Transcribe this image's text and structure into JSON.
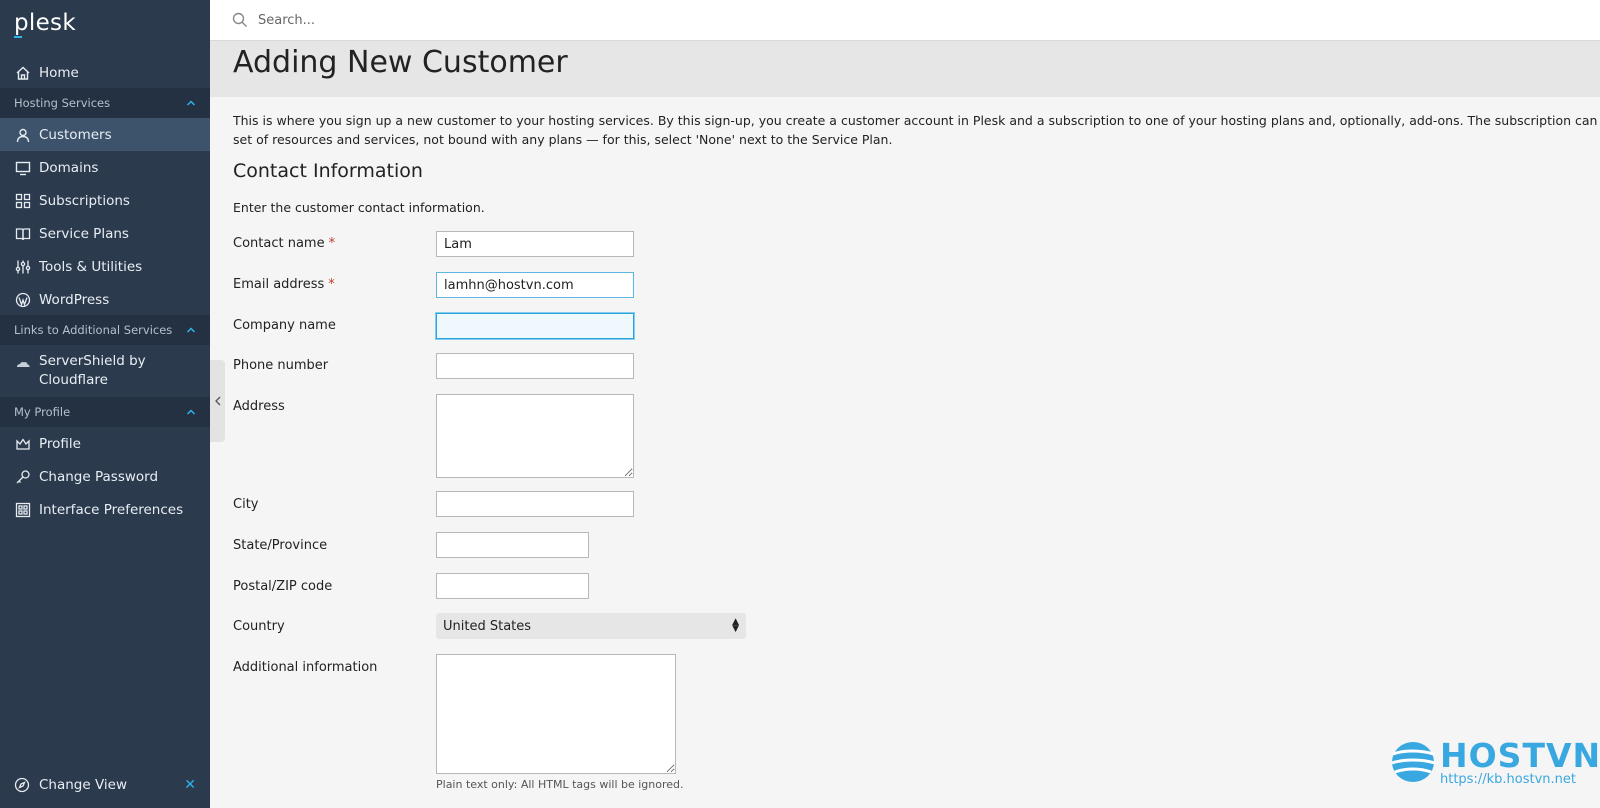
{
  "app": {
    "logo": "plesk"
  },
  "search": {
    "placeholder": "Search..."
  },
  "sidebar": {
    "home": "Home",
    "section_hosting": "Hosting Services",
    "customers": "Customers",
    "domains": "Domains",
    "subscriptions": "Subscriptions",
    "service_plans": "Service Plans",
    "tools": "Tools & Utilities",
    "wordpress": "WordPress",
    "section_links": "Links to Additional Services",
    "servershield_line1": "ServerShield by",
    "servershield_line2": "Cloudflare",
    "section_profile": "My Profile",
    "profile": "Profile",
    "change_password": "Change Password",
    "interface_prefs": "Interface Preferences",
    "change_view": "Change View"
  },
  "page": {
    "title": "Adding New Customer",
    "intro_line1": "This is where you sign up a new customer to your hosting services. By this sign-up, you create a customer account in Plesk and a subscription to one of your hosting plans and, optionally, add-ons. The subscription can also pro",
    "intro_line2": "set of resources and services, not bound with any plans — for this, select 'None' next to the Service Plan."
  },
  "contact": {
    "title": "Contact Information",
    "description": "Enter the customer contact information.",
    "contact_name_label": "Contact name",
    "contact_name_value": "Lam",
    "email_label": "Email address",
    "email_value": "lamhn@hostvn.com",
    "company_label": "Company name",
    "company_value": "",
    "phone_label": "Phone number",
    "address_label": "Address",
    "city_label": "City",
    "state_label": "State/Province",
    "zip_label": "Postal/ZIP code",
    "country_label": "Country",
    "country_value": "United States",
    "additional_label": "Additional information",
    "additional_hint": "Plain text only: All HTML tags will be ignored.",
    "required_mark": "*"
  },
  "watermark": {
    "name": "HOSTVN",
    "url": "https://kb.hostvn.net"
  },
  "colors": {
    "sidebar_bg": "#2b3a4d",
    "sidebar_active": "#3d526b",
    "accent": "#2cb4ef",
    "focus": "#2aa5dc"
  }
}
